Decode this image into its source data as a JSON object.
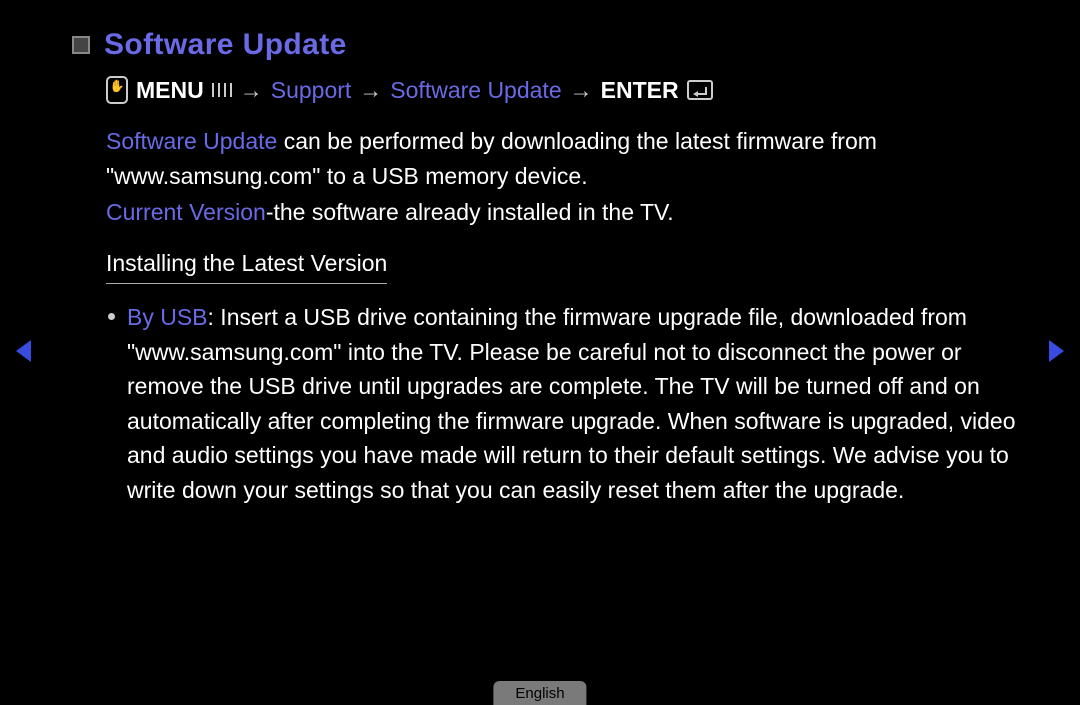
{
  "heading": "Software Update",
  "path": {
    "menu": "MENU",
    "arrow": "→",
    "support": "Support",
    "software_update": "Software Update",
    "enter": "ENTER"
  },
  "intro": {
    "label": "Software Update",
    "text": " can be performed by downloading the latest firmware from \"www.samsung.com\" to a USB memory device."
  },
  "current": {
    "label": "Current Version",
    "text": "-the software already installed in the TV."
  },
  "section_heading": "Installing the Latest Version",
  "bullet": {
    "label": "By USB",
    "text": ": Insert a USB drive containing the firmware upgrade file, downloaded from \"www.samsung.com\" into the TV. Please be careful not to disconnect the power or remove the USB drive until upgrades are complete. The TV will be turned off and on automatically after completing the firmware upgrade. When software is upgraded, video and audio settings you have made will return to their default settings. We advise you to write down your settings so that you can easily reset them after the upgrade."
  },
  "language": "English"
}
